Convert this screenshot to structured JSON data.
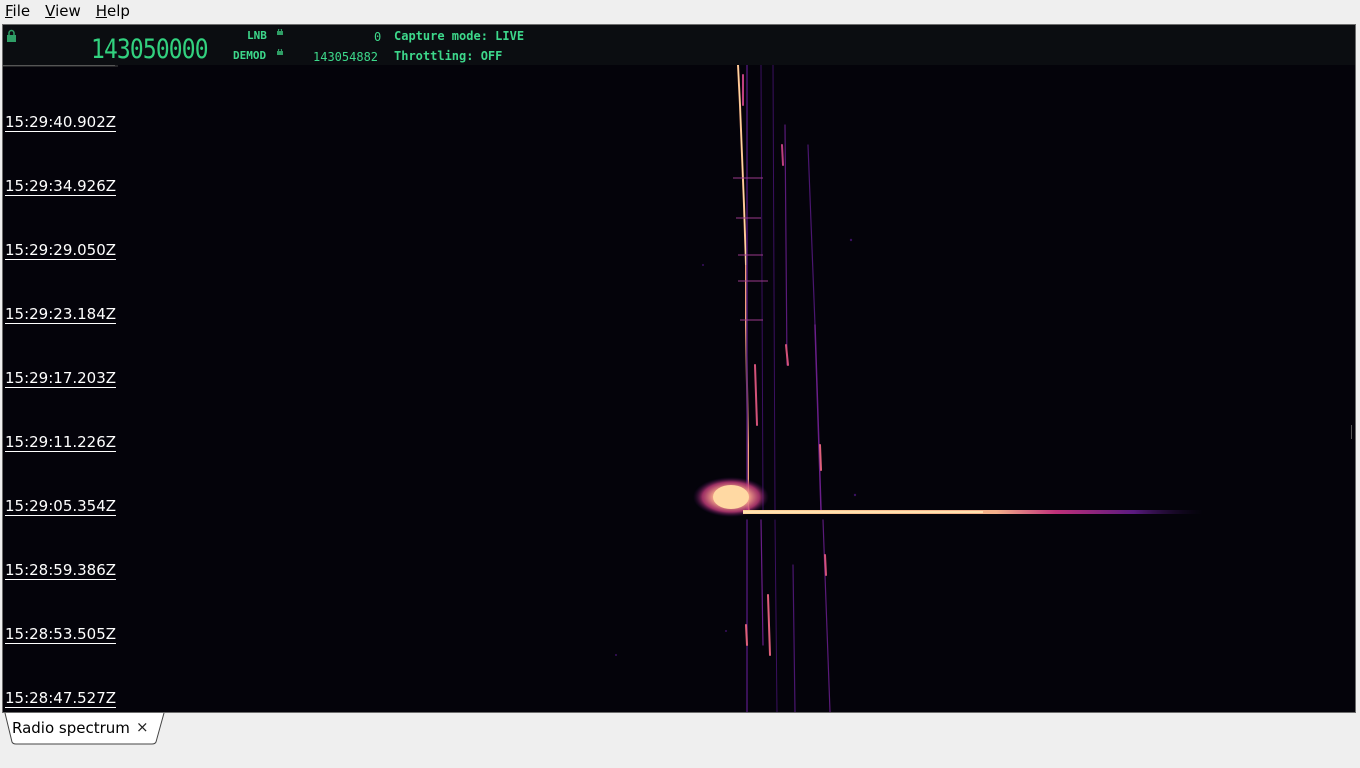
{
  "menu": {
    "file": "File",
    "view": "View",
    "help": "Help"
  },
  "header": {
    "frequency_display": "143050000",
    "lnb_label": "LNB",
    "lnb_value": "0",
    "demod_label": "DEMOD",
    "demod_value": "143054882",
    "capture_mode": "Capture mode: LIVE",
    "throttling": "Throttling: OFF"
  },
  "timestamps": [
    "15:29:40.902Z",
    "15:29:34.926Z",
    "15:29:29.050Z",
    "15:29:23.184Z",
    "15:29:17.203Z",
    "15:29:11.226Z",
    "15:29:05.354Z",
    "15:28:59.386Z",
    "15:28:53.505Z",
    "15:28:47.527Z"
  ],
  "tab": {
    "label": "Radio spectrum",
    "close": "×"
  },
  "colors": {
    "accent_green": "#3dd88b",
    "waterfall_bg": "#04030a",
    "signal_hot": "#ffd49a",
    "signal_warm": "#e05a7a",
    "signal_cool": "#6a1e8a"
  }
}
